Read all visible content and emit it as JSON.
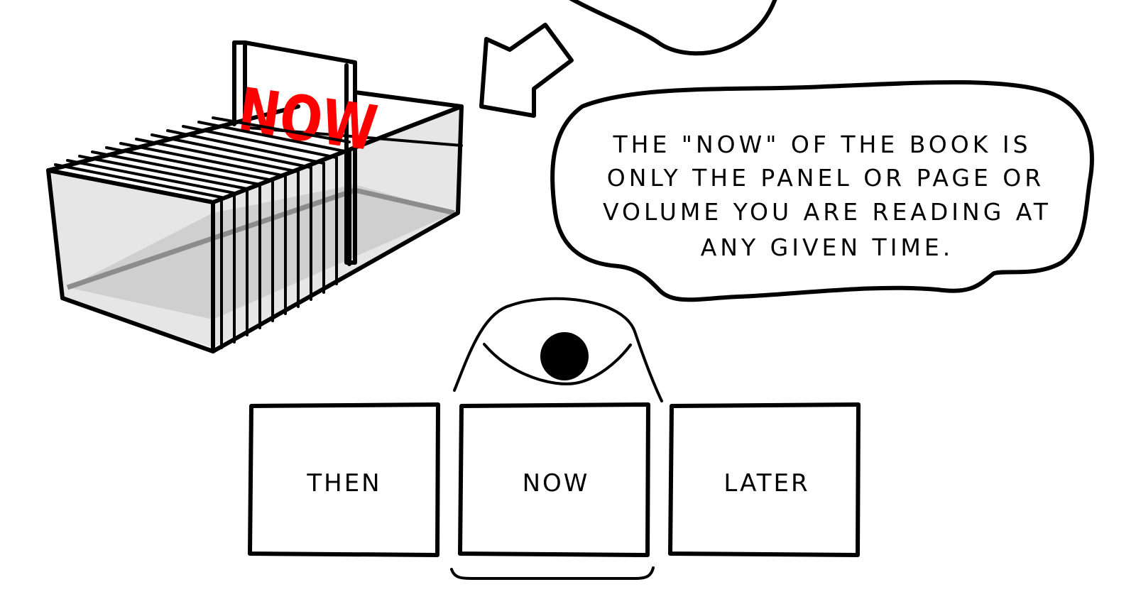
{
  "sign": {
    "text": "NOW",
    "color": "#ff0000"
  },
  "speech_bubble": {
    "lines": [
      "THE \"NOW\" OF THE BOOK IS",
      "ONLY THE PANEL OR PAGE OR",
      "VOLUME YOU ARE READING AT",
      "ANY GIVEN TIME."
    ]
  },
  "panels": [
    {
      "label": "THEN"
    },
    {
      "label": "NOW"
    },
    {
      "label": "LATER"
    }
  ],
  "icons": {
    "pointer": "arrow-down-left-icon",
    "viewer": "eye-icon"
  },
  "colors": {
    "ink": "#000000",
    "box_glass": "#e6e6e6",
    "box_floor": "#cfcfcf",
    "accent": "#ff0000"
  }
}
